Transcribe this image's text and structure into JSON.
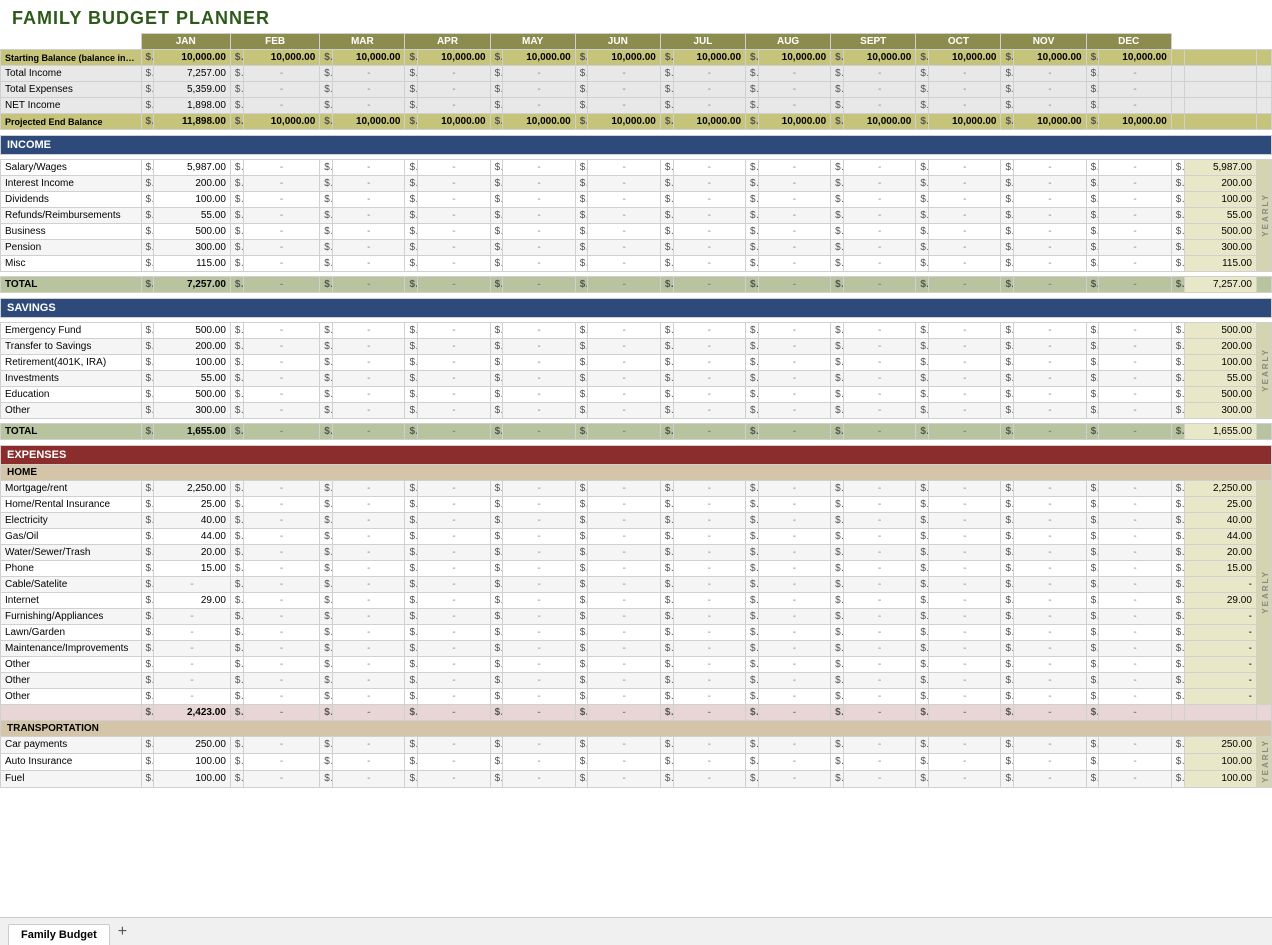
{
  "app": {
    "title": "FAMILY BUDGET PLANNER"
  },
  "tab": {
    "name": "Family Budget",
    "add_icon": "+"
  },
  "months": [
    "JAN",
    "FEB",
    "MAR",
    "APR",
    "MAY",
    "JUN",
    "JUL",
    "AUG",
    "SEPT",
    "OCT",
    "NOV",
    "DEC"
  ],
  "summary": {
    "rows": [
      {
        "label": "Starting Balance (balance in acct)",
        "jan": "10,000.00",
        "rest": "10,000.00",
        "all_same": true
      },
      {
        "label": "Total Income",
        "jan": "7,257.00",
        "rest": "-"
      },
      {
        "label": "Total Expenses",
        "jan": "5,359.00",
        "rest": "-"
      },
      {
        "label": "NET Income",
        "jan": "1,898.00",
        "rest": "-"
      },
      {
        "label": "Projected End Balance",
        "jan": "11,898.00",
        "rest": "10,000.00",
        "all_same": true
      }
    ]
  },
  "income": {
    "section_label": "INCOME",
    "rows": [
      {
        "label": "Salary/Wages",
        "jan": "5,987.00",
        "yearly": "5,987.00"
      },
      {
        "label": "Interest Income",
        "jan": "200.00",
        "yearly": "200.00"
      },
      {
        "label": "Dividends",
        "jan": "100.00",
        "yearly": "100.00"
      },
      {
        "label": "Refunds/Reimbursements",
        "jan": "55.00",
        "yearly": "55.00"
      },
      {
        "label": "Business",
        "jan": "500.00",
        "yearly": "500.00"
      },
      {
        "label": "Pension",
        "jan": "300.00",
        "yearly": "300.00"
      },
      {
        "label": "Misc",
        "jan": "115.00",
        "yearly": "115.00"
      }
    ],
    "total_label": "TOTAL",
    "total_jan": "7,257.00",
    "total_yearly": "7,257.00"
  },
  "savings": {
    "section_label": "SAVINGS",
    "rows": [
      {
        "label": "Emergency Fund",
        "jan": "500.00",
        "yearly": "500.00"
      },
      {
        "label": "Transfer to Savings",
        "jan": "200.00",
        "yearly": "200.00"
      },
      {
        "label": "Retirement(401K, IRA)",
        "jan": "100.00",
        "yearly": "100.00"
      },
      {
        "label": "Investments",
        "jan": "55.00",
        "yearly": "55.00"
      },
      {
        "label": "Education",
        "jan": "500.00",
        "yearly": "500.00"
      },
      {
        "label": "Other",
        "jan": "300.00",
        "yearly": "300.00"
      }
    ],
    "total_label": "TOTAL",
    "total_jan": "1,655.00",
    "total_yearly": "1,655.00"
  },
  "expenses": {
    "section_label": "EXPENSES",
    "home": {
      "label": "HOME",
      "rows": [
        {
          "label": "Mortgage/rent",
          "jan": "2,250.00",
          "yearly": "2,250.00"
        },
        {
          "label": "Home/Rental Insurance",
          "jan": "25.00",
          "yearly": "25.00"
        },
        {
          "label": "Electricity",
          "jan": "40.00",
          "yearly": "40.00"
        },
        {
          "label": "Gas/Oil",
          "jan": "44.00",
          "yearly": "44.00"
        },
        {
          "label": "Water/Sewer/Trash",
          "jan": "20.00",
          "yearly": "20.00"
        },
        {
          "label": "Phone",
          "jan": "15.00",
          "yearly": "15.00"
        },
        {
          "label": "Cable/Satelite",
          "jan": "-",
          "yearly": "-"
        },
        {
          "label": "Internet",
          "jan": "29.00",
          "yearly": "29.00"
        },
        {
          "label": "Furnishing/Appliances",
          "jan": "-",
          "yearly": "-"
        },
        {
          "label": "Lawn/Garden",
          "jan": "-",
          "yearly": "-"
        },
        {
          "label": "Maintenance/Improvements",
          "jan": "-",
          "yearly": "-"
        },
        {
          "label": "Other",
          "jan": "-",
          "yearly": "-"
        },
        {
          "label": "Other",
          "jan": "-",
          "yearly": "-"
        },
        {
          "label": "Other",
          "jan": "-",
          "yearly": "-"
        }
      ],
      "subtotal_jan": "2,423.00"
    },
    "transport": {
      "label": "TRANSPORTATION",
      "rows": [
        {
          "label": "Car payments",
          "jan": "250.00",
          "yearly": "250.00"
        },
        {
          "label": "Auto Insurance",
          "jan": "100.00",
          "yearly": "100.00"
        },
        {
          "label": "Fuel",
          "jan": "100.00",
          "yearly": "100.00"
        }
      ]
    }
  },
  "yearly_label": "Y\nE\nA\nR\nL\nY"
}
